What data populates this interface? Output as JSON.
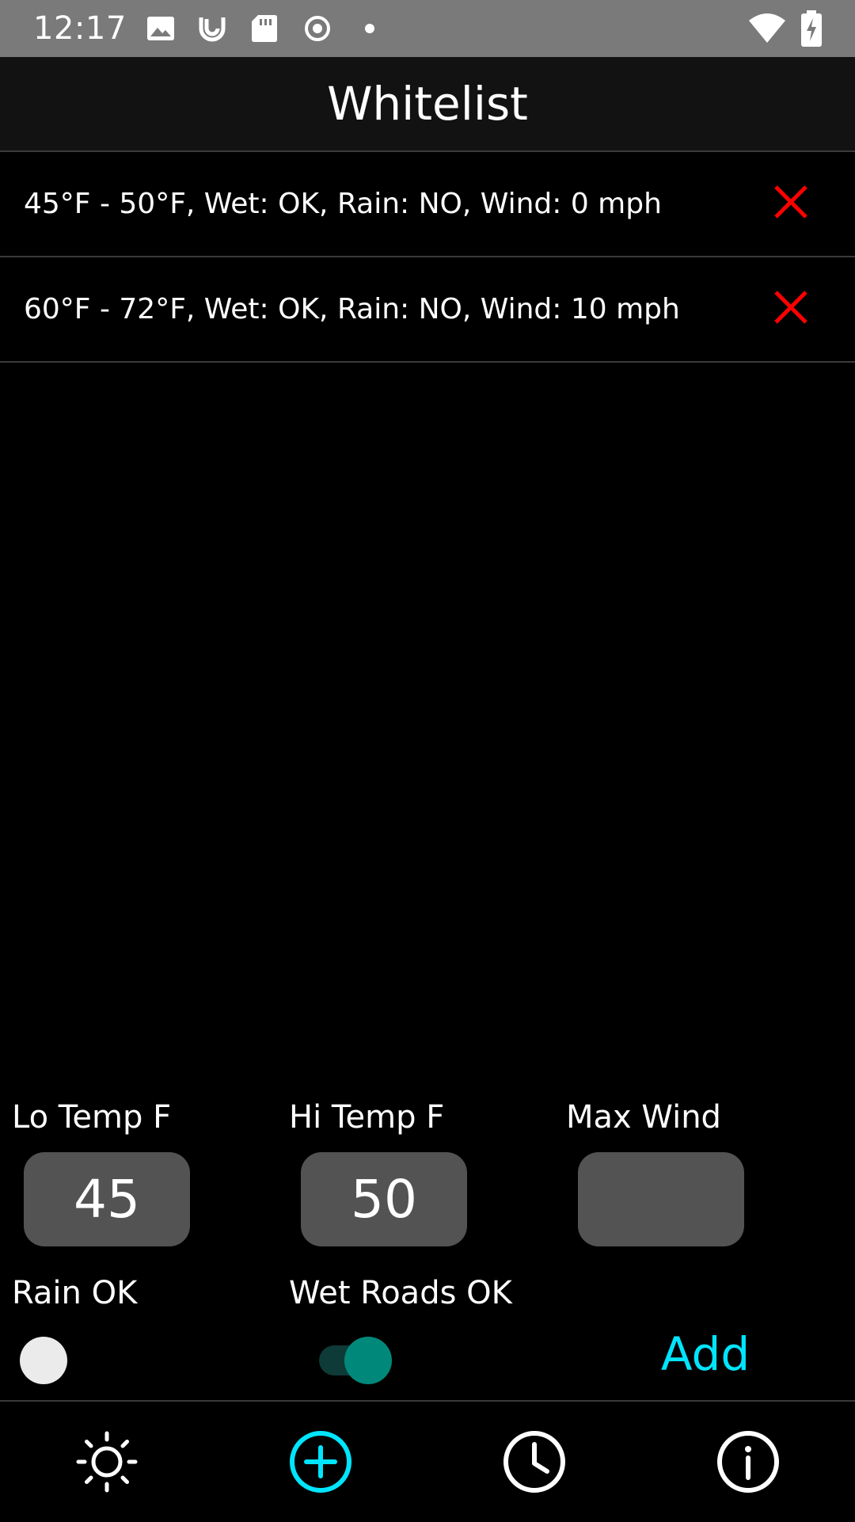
{
  "status_bar": {
    "time": "12:17",
    "icons": [
      "image-icon",
      "refresh-icon",
      "sd-card-icon",
      "record-icon",
      "dot-icon",
      "wifi-icon",
      "battery-charging-icon"
    ]
  },
  "app_bar": {
    "title": "Whitelist"
  },
  "whitelist": {
    "items": [
      {
        "label": "45°F - 50°F, Wet: OK, Rain: NO, Wind: 0 mph"
      },
      {
        "label": "60°F - 72°F, Wet: OK, Rain: NO, Wind: 10 mph"
      }
    ],
    "delete_icon_color": "#ff0000"
  },
  "form": {
    "lo_temp": {
      "label": "Lo Temp F",
      "value": "45"
    },
    "hi_temp": {
      "label": "Hi Temp F",
      "value": "50"
    },
    "max_wind": {
      "label": "Max Wind",
      "value": ""
    },
    "rain_ok": {
      "label": "Rain OK",
      "checked": false
    },
    "wet_roads_ok": {
      "label": "Wet Roads OK",
      "checked": true
    },
    "add_label": "Add"
  },
  "bottom_nav": {
    "items": [
      {
        "icon": "sun-icon",
        "active": false
      },
      {
        "icon": "add-circle-icon",
        "active": true
      },
      {
        "icon": "clock-icon",
        "active": false
      },
      {
        "icon": "info-icon",
        "active": false
      }
    ]
  },
  "colors": {
    "accent": "#00e5ff",
    "switch_on": "#00897b",
    "delete": "#ff0000",
    "input_bg": "#535353"
  }
}
